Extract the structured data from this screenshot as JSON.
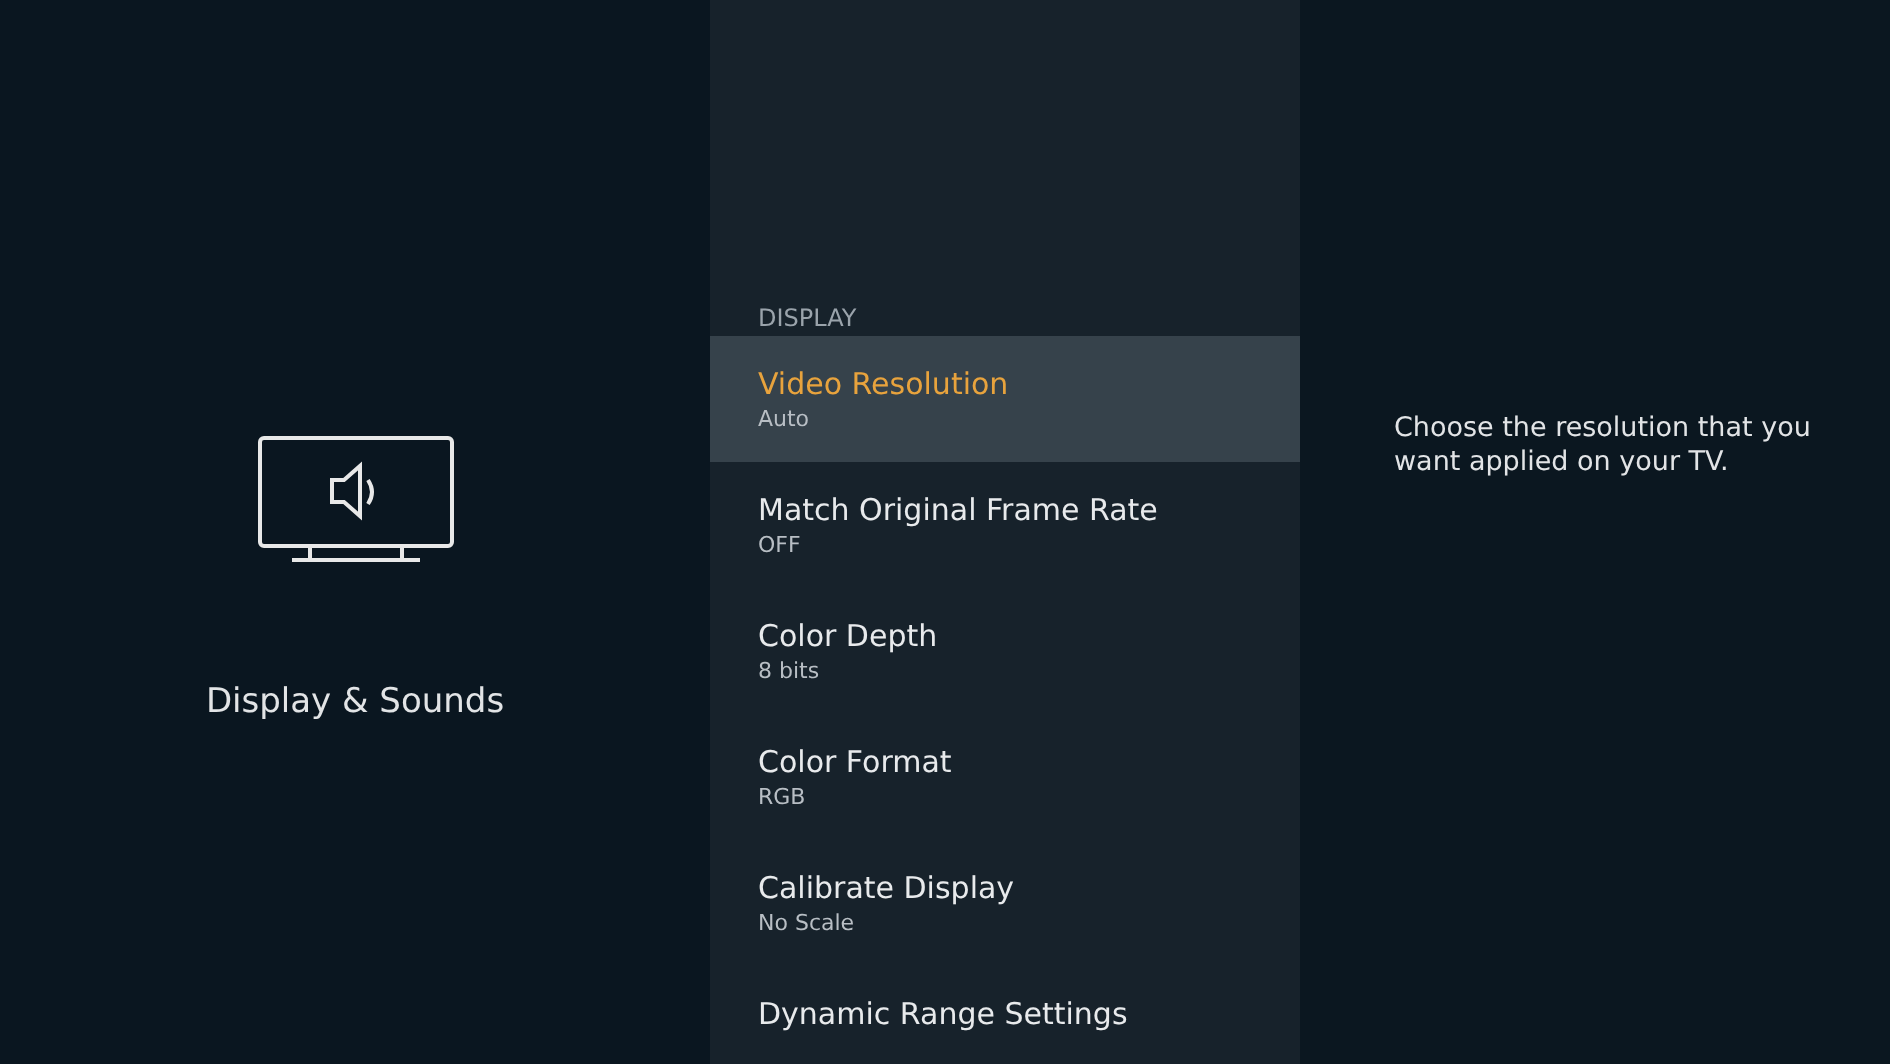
{
  "category": {
    "title": "Display & Sounds"
  },
  "menu": {
    "header": "DISPLAY",
    "items": [
      {
        "title": "Video Resolution",
        "value": "Auto",
        "selected": true
      },
      {
        "title": "Match Original Frame Rate",
        "value": "OFF",
        "selected": false
      },
      {
        "title": "Color Depth",
        "value": "8 bits",
        "selected": false
      },
      {
        "title": "Color Format",
        "value": "RGB",
        "selected": false
      },
      {
        "title": "Calibrate Display",
        "value": "No Scale",
        "selected": false
      },
      {
        "title": "Dynamic Range Settings",
        "selected": false
      }
    ]
  },
  "description": "Choose the resolution that you want applied on your TV."
}
